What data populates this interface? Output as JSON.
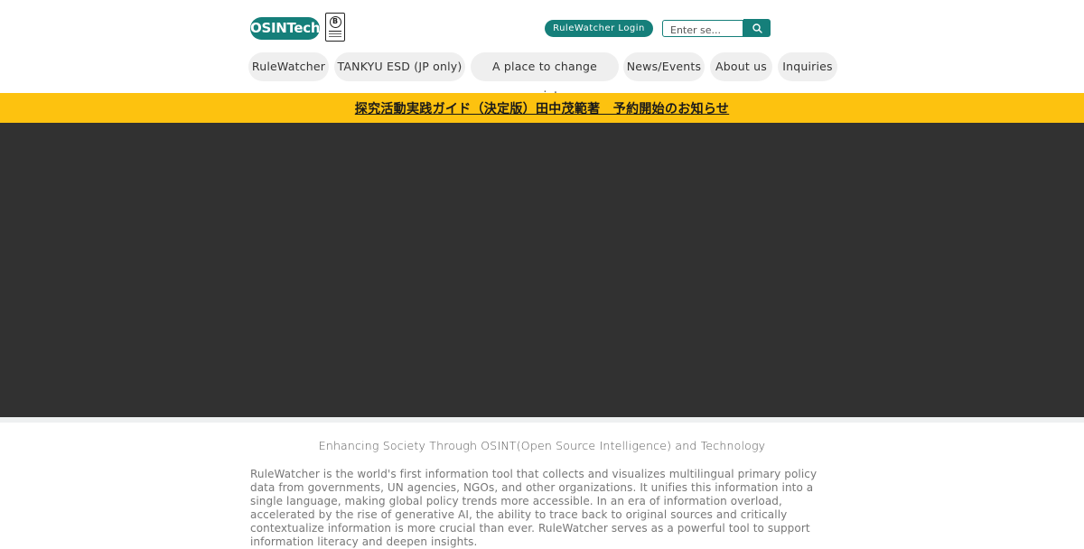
{
  "header": {
    "logo_text": "OSINTech",
    "bcorp_letter": "B",
    "login_label": "RuleWatcher Login",
    "search_placeholder": "Enter se..."
  },
  "nav": {
    "items": [
      {
        "label": "RuleWatcher"
      },
      {
        "label": "TANKYU ESD (JP only)"
      },
      {
        "label": "A place to change society"
      },
      {
        "label": "News/Events"
      },
      {
        "label": "About us"
      },
      {
        "label": "Inquiries"
      }
    ]
  },
  "banner": {
    "text": "探究活動実践ガイド（決定版）田中茂範著　予約開始のお知らせ"
  },
  "main": {
    "tagline": "Enhancing Society Through OSINT(Open Source Intelligence) and Technology",
    "body": "RuleWatcher is the world's first information tool that collects and visualizes multilingual primary policy data from governments, UN agencies, NGOs, and other organizations. It unifies this information into a single language, making global policy trends more accessible. In an era of information overload, accelerated by the rise of generative AI, the ability to trace back to original sources and critically contextualize information is more crucial than ever. RuleWatcher serves as a powerful tool to support information literacy and deepen insights."
  },
  "colors": {
    "brand": "#157f7a",
    "banner": "#fdc20f",
    "hero": "#313131"
  }
}
